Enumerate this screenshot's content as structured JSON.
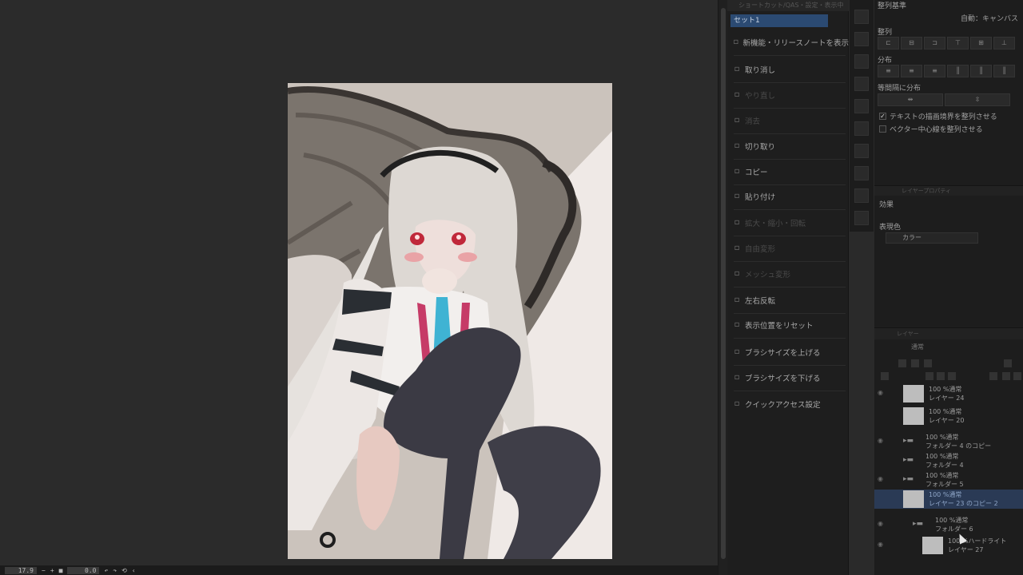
{
  "bottom_bar": {
    "zoom": "17.9",
    "rotation": "0.0"
  },
  "quick_access": {
    "title": "ショートカット/QAS・設定・表示中",
    "set_name": "セット1",
    "items": [
      {
        "label": "新機能・リリースノートを表示",
        "state": "on",
        "icon": "info-icon"
      },
      {
        "label": "取り消し",
        "state": "on",
        "icon": "undo-icon"
      },
      {
        "label": "やり直し",
        "state": "dim",
        "icon": "redo-icon"
      },
      {
        "label": "消去",
        "state": "dim",
        "icon": "erase-icon"
      },
      {
        "label": "切り取り",
        "state": "on",
        "icon": "scissors-icon"
      },
      {
        "label": "コピー",
        "state": "on",
        "icon": "copy-icon"
      },
      {
        "label": "貼り付け",
        "state": "on",
        "icon": "paste-icon"
      },
      {
        "label": "拡大・縮小・回転",
        "state": "dim",
        "icon": "transform-icon"
      },
      {
        "label": "自由変形",
        "state": "dim",
        "icon": "free-transform-icon"
      },
      {
        "label": "メッシュ変形",
        "state": "dim",
        "icon": "mesh-icon"
      },
      {
        "label": "左右反転",
        "state": "on",
        "icon": "flip-icon"
      },
      {
        "label": "表示位置をリセット",
        "state": "on",
        "icon": "reset-view-icon"
      },
      {
        "label": "ブラシサイズを上げる",
        "state": "on",
        "icon": "brush-up-icon"
      },
      {
        "label": "ブラシサイズを下げる",
        "state": "on",
        "icon": "brush-down-icon"
      },
      {
        "label": "クイックアクセス設定",
        "state": "on",
        "icon": "settings-icon"
      }
    ]
  },
  "align_panel": {
    "header": "整列基準",
    "basis_value": "自動：キャンバス",
    "align_label": "整列",
    "distribute_label": "分布",
    "equal_spacing_label": "等間隔に分布",
    "check_text_bounds": "テキストの描画境界を整列させる",
    "check_vector_center": "ベクター中心線を整列させる",
    "check_text_bounds_on": true,
    "check_vector_center_on": false
  },
  "layer_property": {
    "title": "レイヤープロパティ",
    "effect_label": "効果",
    "expression_color_label": "表現色",
    "expression_color_value": "カラー"
  },
  "layer_panel": {
    "title": "レイヤー",
    "blend_mode": "通常",
    "layers": [
      {
        "mode": "100 %通常",
        "name": "レイヤー 24",
        "type": "layer",
        "visible": true,
        "selected": false
      },
      {
        "mode": "100 %通常",
        "name": "レイヤー 20",
        "type": "layer",
        "visible": false,
        "selected": false
      },
      {
        "mode": "100 %通常",
        "name": "フォルダー 4 のコピー",
        "type": "folder",
        "visible": true,
        "selected": false
      },
      {
        "mode": "100 %通常",
        "name": "フォルダー 4",
        "type": "folder",
        "visible": false,
        "selected": false
      },
      {
        "mode": "100 %通常",
        "name": "フォルダー 5",
        "type": "folder",
        "visible": true,
        "selected": false
      },
      {
        "mode": "100 %通常",
        "name": "レイヤー 23 のコピー 2",
        "type": "layer",
        "visible": false,
        "selected": true
      },
      {
        "mode": "100 %通常",
        "name": "フォルダー 6",
        "type": "folder",
        "visible": true,
        "selected": false
      },
      {
        "mode": "100 %ハードライト",
        "name": "レイヤー 27",
        "type": "layer",
        "visible": true,
        "selected": false
      }
    ]
  }
}
